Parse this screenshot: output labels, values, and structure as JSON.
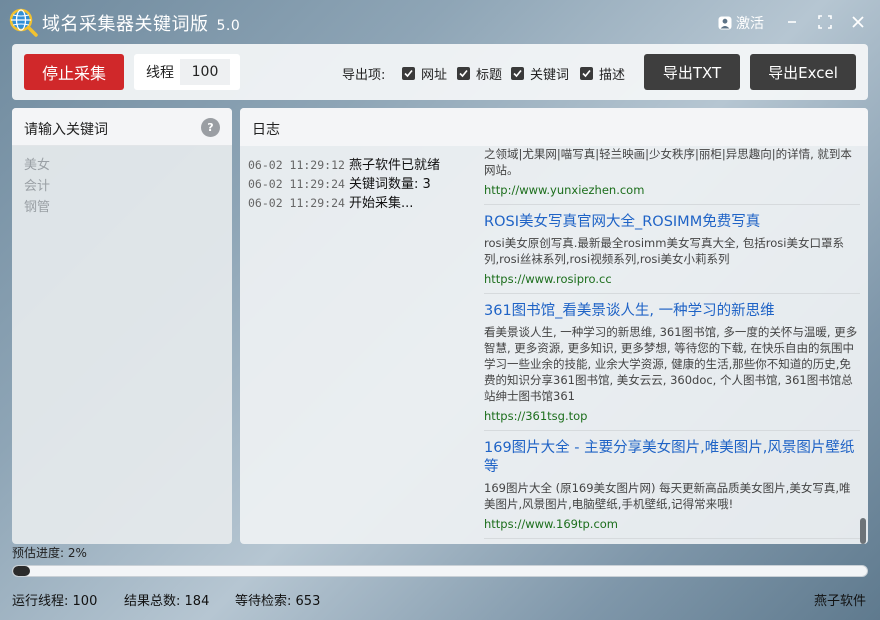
{
  "window": {
    "title": "域名采集器关键词版",
    "version": "5.0",
    "activate_label": "激活"
  },
  "toolbar": {
    "stop_label": "停止采集",
    "thread_label": "线程",
    "thread_value": "100",
    "export_label": "导出项:",
    "export_options": [
      {
        "label": "网址",
        "checked": true
      },
      {
        "label": "标题",
        "checked": true
      },
      {
        "label": "关键词",
        "checked": true
      },
      {
        "label": "描述",
        "checked": true
      }
    ],
    "export_txt_label": "导出TXT",
    "export_excel_label": "导出Excel"
  },
  "keywords": {
    "title": "请输入关键词",
    "help_label": "?",
    "items": [
      "美女",
      "会计",
      "钢管"
    ]
  },
  "log": {
    "title": "日志",
    "lines": [
      {
        "time": "06-02 11:29:12",
        "msg": "燕子软件已就绪"
      },
      {
        "time": "06-02 11:29:24",
        "msg": "关键词数量: 3"
      },
      {
        "time": "06-02 11:29:24",
        "msg": "开始采集..."
      }
    ],
    "results": [
      {
        "title": "",
        "desc": "之领域|尤果网|喵写真|轻兰映画|少女秩序|丽柜|异思趣向|的详情, 就到本网站。",
        "url": "http://www.yunxiezhen.com"
      },
      {
        "title": "ROSI美女写真官网大全_ROSIMM免费写真",
        "desc": "rosi美女原创写真.最新最全rosimm美女写真大全, 包括rosi美女口罩系列,rosi丝袜系列,rosi视频系列,rosi美女小莉系列",
        "url": "https://www.rosipro.cc"
      },
      {
        "title": "361图书馆_看美景谈人生, 一种学习的新思维",
        "desc": "看美景谈人生, 一种学习的新思维, 361图书馆, 多一度的关怀与温暖, 更多智慧, 更多资源, 更多知识, 更多梦想, 等待您的下载, 在快乐自由的氛围中学习一些业余的技能, 业余大学资源, 健康的生活,那些你不知道的历史,免费的知识分享361图书馆, 美女云云, 360doc, 个人图书馆, 361图书馆总站绅士图书馆361",
        "url": "https://361tsg.top"
      },
      {
        "title": "169图片大全 - 主要分享美女图片,唯美图片,风景图片壁纸等",
        "desc": "169图片大全 (原169美女图片网) 每天更新高品质美女图片,美女写真,唯美图片,风景图片,电脑壁纸,手机壁纸,记得常来哦!",
        "url": "https://www.169tp.com"
      }
    ]
  },
  "progress": {
    "label": "预估进度: 2%",
    "fraction": 0.02
  },
  "status": {
    "running_threads_label": "运行线程:",
    "running_threads": "100",
    "total_results_label": "结果总数:",
    "total_results": "184",
    "pending_label": "等待检索:",
    "pending": "653",
    "brand": "燕子软件"
  },
  "colors": {
    "stop_button": "#d0282a",
    "dark_button": "#3e3e3e",
    "link_title": "#1f63c6",
    "link_url": "#1c6e1c"
  }
}
